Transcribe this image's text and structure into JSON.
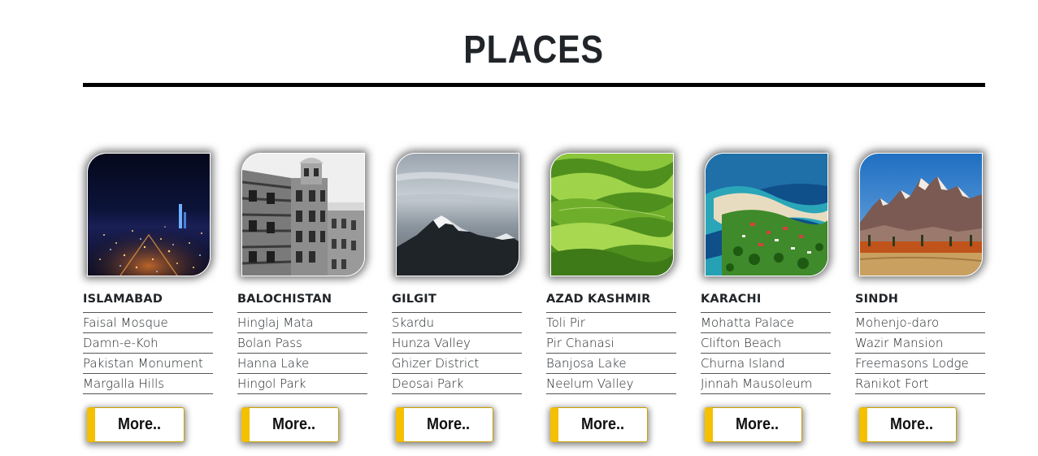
{
  "page": {
    "title": "PLACES"
  },
  "colors": {
    "button_accent": "#f5c000",
    "rule": "#000000",
    "text": "#212529"
  },
  "regions": [
    {
      "name": "ISLAMABAD",
      "image_icon": "city-night-skyline-image",
      "places": [
        "Faisal Mosque",
        "Damn-e-Koh",
        "Pakistan Monument",
        "Margalla Hills"
      ],
      "button_label": "More.."
    },
    {
      "name": "BALOCHISTAN",
      "image_icon": "historic-palace-image",
      "places": [
        "Hinglaj Mata",
        "Bolan Pass",
        "Hanna Lake",
        "Hingol Park"
      ],
      "button_label": "More.."
    },
    {
      "name": "GILGIT",
      "image_icon": "snow-mountain-image",
      "places": [
        "Skardu",
        "Hunza Valley",
        "Ghizer District",
        "Deosai Park"
      ],
      "button_label": "More.."
    },
    {
      "name": "AZAD KASHMIR",
      "image_icon": "green-hills-image",
      "places": [
        "Toli Pir",
        "Pir Chanasi",
        "Banjosa Lake",
        "Neelum Valley"
      ],
      "button_label": "More.."
    },
    {
      "name": "KARACHI",
      "image_icon": "coastal-island-image",
      "places": [
        "Mohatta Palace",
        "Clifton Beach",
        "Churna Island",
        "Jinnah Mausoleum"
      ],
      "button_label": "More.."
    },
    {
      "name": "SINDH",
      "image_icon": "mountain-range-image",
      "places": [
        "Mohenjo-daro",
        "Wazir Mansion",
        "Freemasons Lodge",
        "Ranikot Fort"
      ],
      "button_label": "More.."
    }
  ]
}
